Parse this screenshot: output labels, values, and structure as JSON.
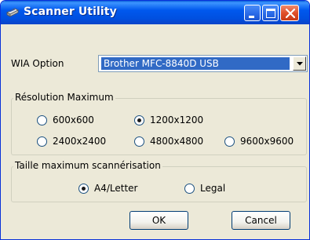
{
  "window": {
    "title": "Scanner Utility",
    "icon": "scanner-icon",
    "controls": [
      "minimize-icon",
      "maximize-icon",
      "close-icon"
    ]
  },
  "wia": {
    "label": "WIA Option",
    "selected": "Brother MFC-8840D USB"
  },
  "resolution": {
    "title": "Résolution Maximum",
    "options": [
      "600x600",
      "1200x1200",
      "2400x2400",
      "4800x4800",
      "9600x9600"
    ],
    "selected": "1200x1200"
  },
  "scan_size": {
    "title": "Taille maximum scannérisation",
    "options": [
      "A4/Letter",
      "Legal"
    ],
    "selected": "A4/Letter"
  },
  "buttons": {
    "ok": "OK",
    "cancel": "Cancel"
  },
  "colors": {
    "titlebar": "#0058ee",
    "selection": "#316ac5",
    "dialog_bg": "#ece9d8",
    "close_button": "#e0502b"
  }
}
